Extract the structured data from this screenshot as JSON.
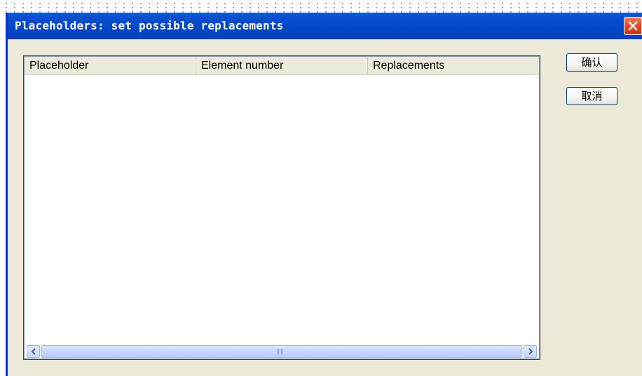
{
  "window": {
    "title": "Placeholders: set possible replacements",
    "colors": {
      "titlebar": "#0047c8",
      "close_button": "#e0431d",
      "face": "#ece9d8"
    }
  },
  "table": {
    "columns": [
      "Placeholder",
      "Element number",
      "Replacements"
    ],
    "rows": []
  },
  "scrollbar": {
    "left_icon": "chevron-left-icon",
    "right_icon": "chevron-right-icon"
  },
  "buttons": {
    "ok_label": "确认",
    "cancel_label": "取消"
  }
}
